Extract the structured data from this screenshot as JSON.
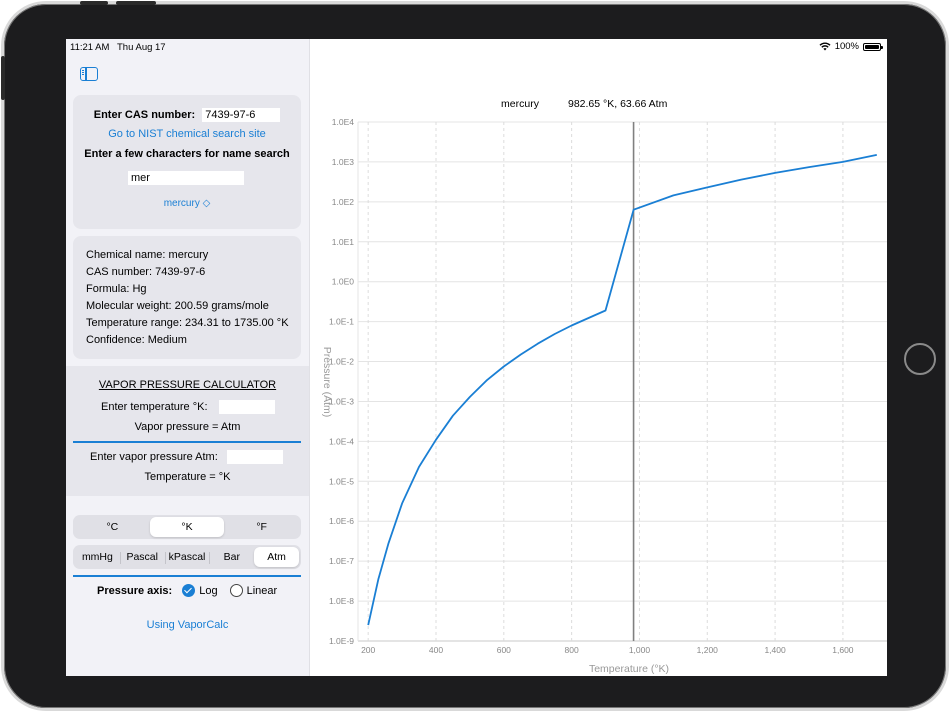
{
  "status": {
    "time": "11:21 AM",
    "date": "Thu Aug 17",
    "battery": "100%"
  },
  "search": {
    "cas_label": "Enter CAS number:",
    "cas_value": "7439-97-6",
    "nist_link": "Go to NIST chemical search site",
    "name_label": "Enter a few characters for name search",
    "name_value": "mer",
    "selected_chemical": "mercury ◇"
  },
  "info": {
    "name": "Chemical name: mercury",
    "cas": "CAS number: 7439-97-6",
    "formula": "Formula: Hg",
    "mw": "Molecular weight: 200.59 grams/mole",
    "range": "Temperature range: 234.31 to 1735.00 °K",
    "confidence": "Confidence: Medium"
  },
  "calculator": {
    "title": "VAPOR PRESSURE CALCULATOR",
    "temp_label": "Enter temperature °K:",
    "temp_value": "",
    "vp_result": "Vapor pressure =  Atm",
    "vp_label": "Enter vapor pressure Atm:",
    "vp_value": "",
    "temp_result": "Temperature =  °K"
  },
  "units": {
    "temperature": [
      "°C",
      "°K",
      "°F"
    ],
    "temperature_selected": 1,
    "pressure": [
      "mmHg",
      "Pascal",
      "kPascal",
      "Bar",
      "Atm"
    ],
    "pressure_selected": 4
  },
  "axis_mode": {
    "label": "Pressure axis:",
    "log": "Log",
    "linear": "Linear",
    "selected": "Log"
  },
  "help_link": "Using VaporCalc",
  "colors": {
    "accent": "#1a7fd4",
    "curve": "#1a7fd4",
    "cursor": "#808080"
  },
  "chart_data": {
    "type": "line",
    "legend_name": "mercury",
    "readout": "982.65 °K, 63.66 Atm",
    "xlabel": "Temperature (°K)",
    "ylabel": "Pressure (Atm)",
    "xlim": [
      170,
      1730
    ],
    "ylim_exp": [
      -9,
      4
    ],
    "yscale": "log",
    "grid": true,
    "x_ticks": [
      200,
      400,
      600,
      800,
      1000,
      1200,
      1400,
      1600
    ],
    "x_tick_labels": [
      "200",
      "400",
      "600",
      "800",
      "1,000",
      "1,200",
      "1,400",
      "1,600"
    ],
    "y_tick_labels": [
      "1.0E-9",
      "1.0E-8",
      "1.0E-7",
      "1.0E-6",
      "1.0E-5",
      "1.0E-4",
      "1.0E-3",
      "1.0E-2",
      "1.0E-1",
      "1.0E0",
      "1.0E1",
      "1.0E2",
      "1.0E3",
      "1.0E4"
    ],
    "cursor_x": 982.65,
    "series": [
      {
        "name": "mercury",
        "x": [
          200,
          230,
          260,
          300,
          350,
          400,
          450,
          500,
          550,
          600,
          650,
          700,
          750,
          800,
          900,
          982.65,
          1100,
          1200,
          1300,
          1400,
          1500,
          1600,
          1700
        ],
        "y": [
          2.5e-09,
          3.5e-08,
          2.8e-07,
          2.8e-06,
          2.3e-05,
          0.00011,
          0.00044,
          0.0013,
          0.0034,
          0.0075,
          0.015,
          0.028,
          0.049,
          0.08,
          0.19,
          63.66,
          145,
          230,
          360,
          530,
          740,
          1000,
          1500
        ]
      }
    ]
  }
}
